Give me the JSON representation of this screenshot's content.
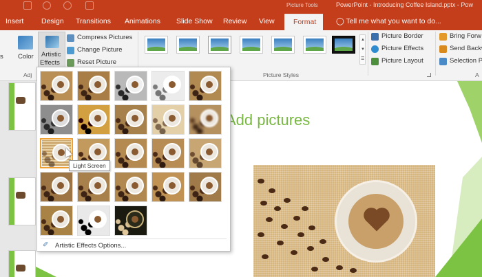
{
  "titlebar": {
    "context_label": "Picture Tools",
    "doc_title": "PowerPoint - Introducing Coffee Island.pptx - Pow"
  },
  "tabs": [
    {
      "label": "Insert"
    },
    {
      "label": "Design"
    },
    {
      "label": "Transitions"
    },
    {
      "label": "Animations"
    },
    {
      "label": "Slide Show"
    },
    {
      "label": "Review"
    },
    {
      "label": "View"
    }
  ],
  "active_tab": {
    "label": "Format"
  },
  "tell_me": {
    "label": "Tell me what you want to do..."
  },
  "ribbon": {
    "color_label": "Color",
    "artistic_effects_label_1": "Artistic",
    "artistic_effects_label_2": "Effects",
    "adjust_group_label": "Adj",
    "compress_label": "Compress Pictures",
    "change_picture_label": "Change Picture",
    "reset_picture_label": "Reset Picture",
    "picture_styles_label": "Picture Styles",
    "picture_border_label": "Picture Border",
    "picture_effects_label": "Picture Effects",
    "picture_layout_label": "Picture Layout",
    "bring_forward_label": "Bring Forw",
    "send_backward_label": "Send Backw",
    "selection_pane_label": "Selection P",
    "arrange_group_label": "A"
  },
  "slide": {
    "heading": "Add pictures"
  },
  "gallery": {
    "tooltip": "Light Screen",
    "options_label": "Artistic Effects Options..."
  },
  "colors": {
    "accent": "#c43e1c",
    "heading_green": "#78b843"
  }
}
